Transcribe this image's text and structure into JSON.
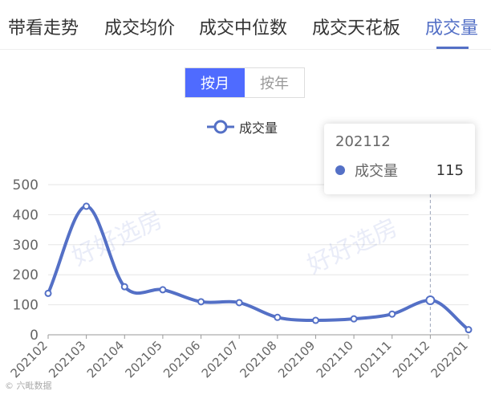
{
  "tabs": [
    {
      "label": "带看走势"
    },
    {
      "label": "成交均价"
    },
    {
      "label": "成交中位数"
    },
    {
      "label": "成交天花板"
    },
    {
      "label": "成交量"
    }
  ],
  "active_tab": 4,
  "toggle": {
    "month_label": "按月",
    "year_label": "按年",
    "active": "month"
  },
  "tooltip": {
    "title": "202112",
    "series_name": "成交量",
    "value": "115"
  },
  "watermark": "好好选房",
  "corner_mark": "© 六毗数据",
  "colors": {
    "accent": "#5470c6",
    "toggle_active": "#4f6bff"
  },
  "chart_data": {
    "type": "line",
    "smooth": true,
    "categories": [
      "202102",
      "202103",
      "202104",
      "202105",
      "202106",
      "202107",
      "202108",
      "202109",
      "202110",
      "202111",
      "202112",
      "202201"
    ],
    "series": [
      {
        "name": "成交量",
        "values": [
          138,
          428,
          160,
          150,
          110,
          107,
          58,
          48,
          53,
          69,
          115,
          17
        ]
      }
    ],
    "ylim": [
      0,
      500
    ],
    "yticks": [
      0,
      100,
      200,
      300,
      400,
      500
    ],
    "grid": true,
    "legend": "top-center",
    "highlight_index": 10
  }
}
